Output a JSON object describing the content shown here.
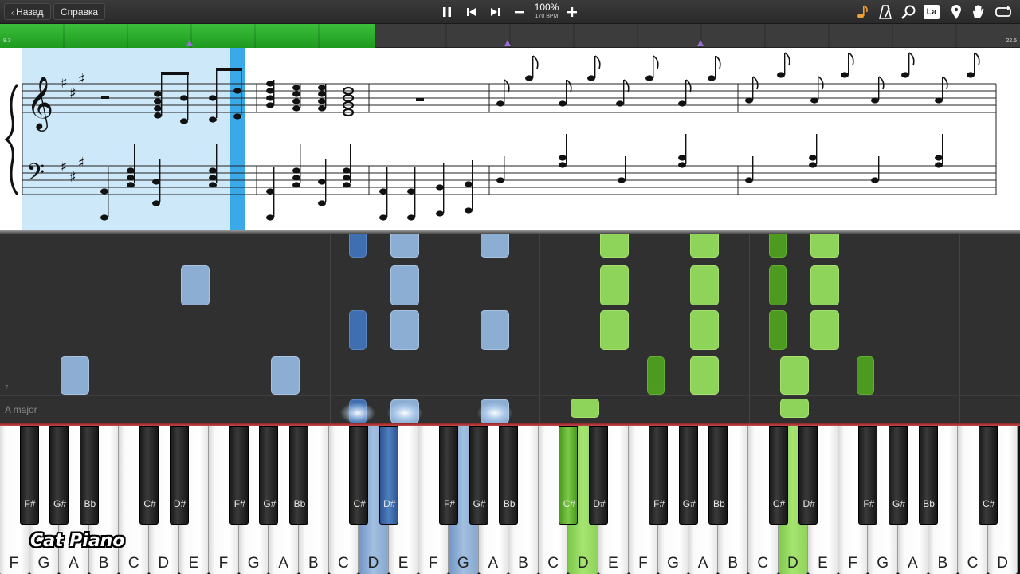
{
  "toolbar": {
    "back_label": "Назад",
    "help_label": "Справка",
    "tempo_percent": "100%",
    "tempo_bpm": "170 BPM",
    "note_label_badge": "La",
    "icons": [
      "pause-icon",
      "skip-back-icon",
      "skip-forward-icon",
      "minus-icon",
      "plus-icon",
      "note-color-icon",
      "metronome-icon",
      "zoom-icon",
      "note-labels-icon",
      "marker-icon",
      "hand-icon",
      "loop-icon"
    ]
  },
  "timeline": {
    "start_label": "8.3",
    "end_label": "22.5",
    "progress_fraction": 0.367
  },
  "roll": {
    "key_signature": "A major",
    "measure_number": "7"
  },
  "keyboard": {
    "white_keys": [
      "F",
      "G",
      "A",
      "B",
      "C",
      "D",
      "E",
      "F",
      "G",
      "A",
      "B",
      "C",
      "D",
      "E",
      "F",
      "G",
      "A",
      "B",
      "C",
      "D",
      "E",
      "F",
      "G",
      "A",
      "B",
      "C",
      "D",
      "E",
      "F",
      "G",
      "A",
      "B",
      "C",
      "D"
    ],
    "black_keys": [
      "F#",
      "G#",
      "Bb",
      "C#",
      "D#",
      "F#",
      "G#",
      "Bb",
      "C#",
      "D#",
      "F#",
      "G#",
      "Bb",
      "C#",
      "D#",
      "F#",
      "G#",
      "Bb",
      "C#",
      "D#",
      "F#",
      "G#",
      "Bb",
      "C#"
    ],
    "watermark": "Cat Piano"
  },
  "colors": {
    "accent_green": "#8ed35a",
    "accent_blue": "#8daed3",
    "playhead": "#3aa9e8"
  }
}
